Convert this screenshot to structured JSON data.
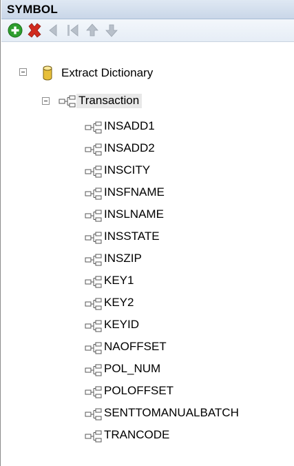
{
  "panel": {
    "title": "SYMBOL"
  },
  "toolbar": {
    "buttons": [
      {
        "name": "add",
        "icon": "add-green-circle-icon",
        "color": "#2e9e2e"
      },
      {
        "name": "delete",
        "icon": "delete-red-x-icon",
        "color": "#d12b1f"
      },
      {
        "name": "previous",
        "icon": "arrow-left-icon",
        "color": "#b8c0ca"
      },
      {
        "name": "first",
        "icon": "skip-first-icon",
        "color": "#b8c0ca"
      },
      {
        "name": "move-up",
        "icon": "arrow-up-icon",
        "color": "#b8c0ca"
      },
      {
        "name": "move-down",
        "icon": "arrow-down-icon",
        "color": "#b8c0ca"
      }
    ]
  },
  "tree": {
    "root": {
      "label": "Extract Dictionary",
      "icon": "database-icon",
      "expanded": true,
      "child": {
        "label": "Transaction",
        "icon": "hierarchy-icon",
        "expanded": true,
        "selected": true,
        "fields": [
          "INSADD1",
          "INSADD2",
          "INSCITY",
          "INSFNAME",
          "INSLNAME",
          "INSSTATE",
          "INSZIP",
          "KEY1",
          "KEY2",
          "KEYID",
          "NAOFFSET",
          "POL_NUM",
          "POLOFFSET",
          "SENTTOMANUALBATCH",
          "TRANCODE"
        ]
      }
    }
  }
}
